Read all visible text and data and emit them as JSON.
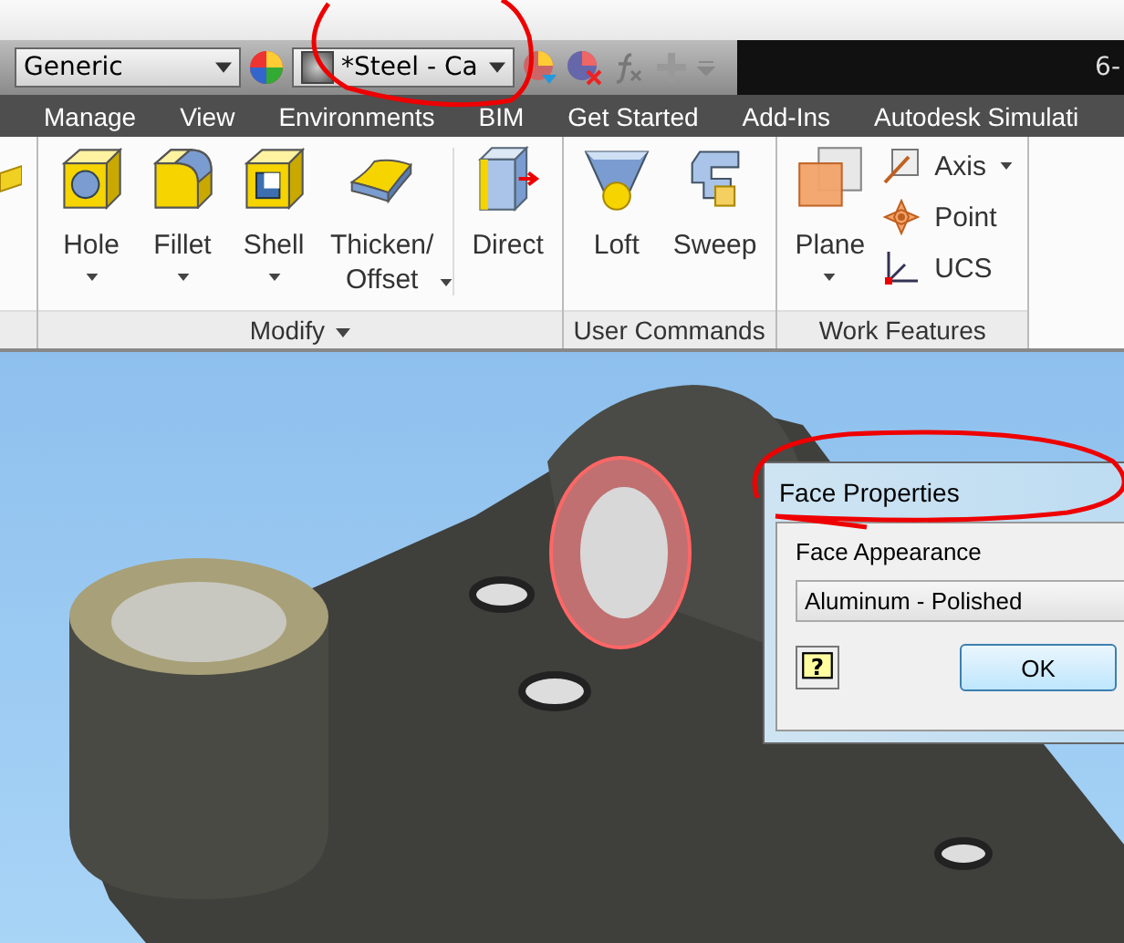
{
  "quick_access": {
    "material_dropdown": "Generic",
    "appearance_dropdown": "*Steel - Ca",
    "title_fragment": "6-"
  },
  "tabs": [
    {
      "label": "Manage",
      "selected": false
    },
    {
      "label": "View",
      "selected": false
    },
    {
      "label": "Environments",
      "selected": false
    },
    {
      "label": "BIM",
      "selected": false
    },
    {
      "label": "Get Started",
      "selected": false
    },
    {
      "label": "Add-Ins",
      "selected": false
    },
    {
      "label": "Autodesk Simulati",
      "selected": false
    }
  ],
  "ribbon_panels": [
    {
      "title": "Modify",
      "title_dropdown": true,
      "tools": [
        {
          "kind": "hole",
          "label": "Hole",
          "dropdown": true
        },
        {
          "kind": "fillet",
          "label": "Fillet",
          "dropdown": true
        },
        {
          "kind": "shell",
          "label": "Shell",
          "dropdown": true
        },
        {
          "kind": "thicken",
          "label": "Thicken/ Offset",
          "dropdown": true
        },
        {
          "kind": "direct",
          "label": "Direct",
          "dropdown": false
        }
      ]
    },
    {
      "title": "User Commands",
      "title_dropdown": false,
      "tools": [
        {
          "kind": "loft",
          "label": "Loft",
          "dropdown": false
        },
        {
          "kind": "sweep",
          "label": "Sweep",
          "dropdown": false
        }
      ]
    },
    {
      "title": "Work Features",
      "title_dropdown": false,
      "tools": [
        {
          "kind": "plane",
          "label": "Plane",
          "dropdown": true
        }
      ],
      "small_tools": [
        {
          "kind": "axis",
          "label": "Axis",
          "dropdown": true
        },
        {
          "kind": "point",
          "label": "Point",
          "dropdown": false
        },
        {
          "kind": "ucs",
          "label": "UCS",
          "dropdown": false
        }
      ]
    }
  ],
  "dialog": {
    "title": "Face Properties",
    "field_label": "Face Appearance",
    "field_value": "Aluminum - Polished",
    "help_glyph": "?",
    "buttons": [
      "OK"
    ]
  }
}
